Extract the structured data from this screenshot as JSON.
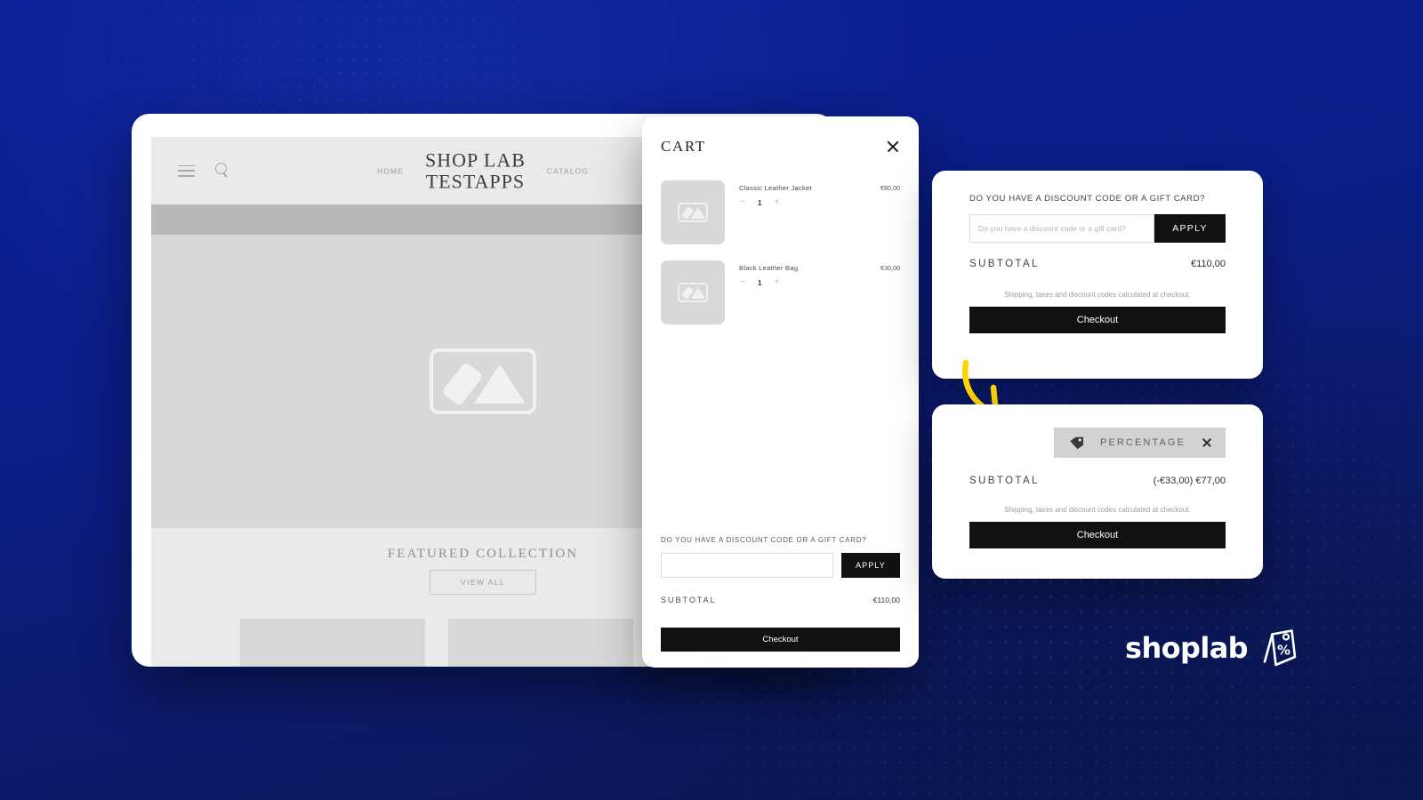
{
  "theme": {
    "bg_blue": "#0b1f96",
    "bg_blue_dark": "#0a1550",
    "accent_yellow": "#ffd400",
    "button_black": "#111111",
    "badge_gray": "#d2d2d2"
  },
  "storefront": {
    "brand_name": "SHOP LAB\nTESTAPPS",
    "nav": [
      {
        "label": "HOME"
      },
      {
        "label": "CATALOG"
      }
    ],
    "icons": {
      "menu": "hamburger-icon",
      "search": "search-icon",
      "placeholder": "image-placeholder-icon"
    },
    "featured": {
      "title": "FEATURED COLLECTION",
      "view_all_label": "VIEW ALL"
    }
  },
  "cart": {
    "title": "CART",
    "close_label": "×",
    "items": [
      {
        "name": "Classic Leather Jacket",
        "price": "€80,00",
        "qty": "1",
        "decrement": "−",
        "increment": "+"
      },
      {
        "name": "Black Leather Bag",
        "price": "€30,00",
        "qty": "1",
        "decrement": "−",
        "increment": "+"
      }
    ],
    "discount_label": "DO YOU HAVE A DISCOUNT CODE OR A GIFT CARD?",
    "discount_placeholder": "",
    "discount_value": "",
    "apply_label": "APPLY",
    "subtotal_label": "SUBTOTAL",
    "subtotal_value": "€110,00",
    "checkout_label": "Checkout"
  },
  "card_before": {
    "discount_label": "DO YOU HAVE A DISCOUNT CODE OR A GIFT CARD?",
    "discount_placeholder": "Do you have a discount code or a gift card?",
    "discount_value": "",
    "apply_label": "APPLY",
    "subtotal_label": "SUBTOTAL",
    "subtotal_value": "€110,00",
    "note": "Shipping, taxes and discount codes calculated at checkout.",
    "checkout_label": "Checkout"
  },
  "card_after": {
    "badge_text": "PERCENTAGE",
    "badge_icon": "price-tag-icon",
    "badge_close": "×",
    "subtotal_label": "SUBTOTAL",
    "subtotal_value": "(-€33,00) €77,00",
    "note": "Shipping, taxes and discount codes calculated at checkout.",
    "checkout_label": "Checkout"
  },
  "annotation": {
    "arrow": "curved-arrow-icon"
  },
  "logo": {
    "text": "shoplab",
    "mark": "price-tag-percent-icon"
  }
}
